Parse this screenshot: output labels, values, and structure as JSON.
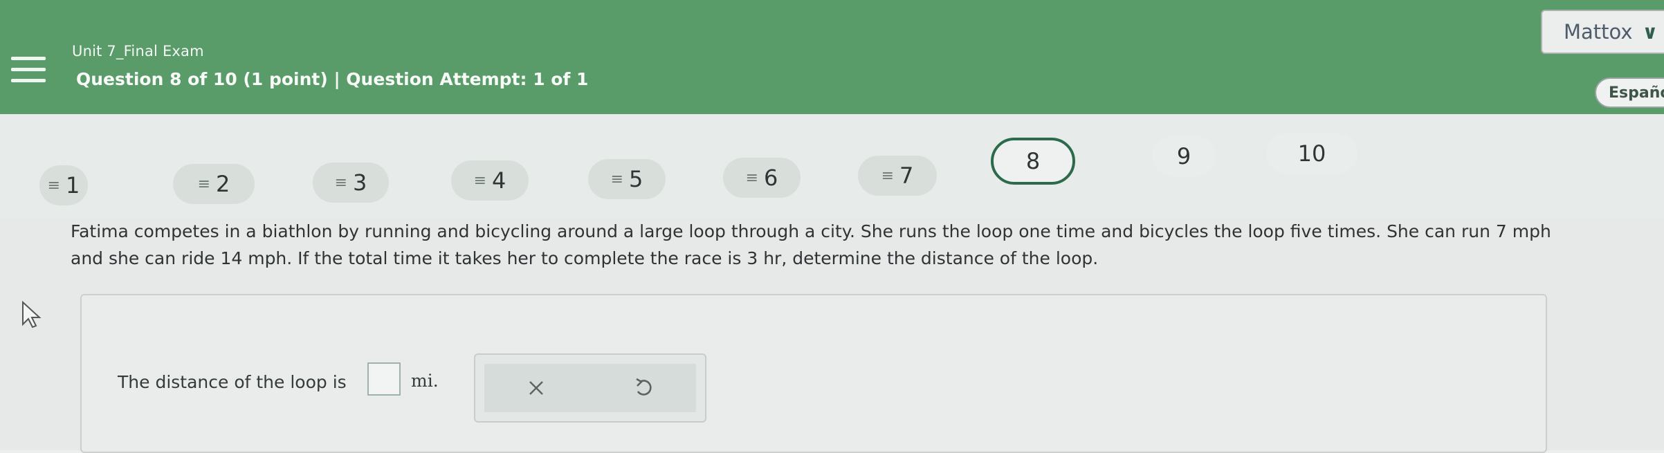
{
  "header": {
    "unit_title": "Unit 7_Final Exam",
    "question_info": "Question 8 of 10 (1 point)  |  Question Attempt: 1 of 1",
    "user_name": "Mattox",
    "language_button": "Español"
  },
  "question_nav": {
    "items": [
      "1",
      "2",
      "3",
      "4",
      "5",
      "6",
      "7",
      "8",
      "9",
      "10"
    ],
    "current": "8"
  },
  "question": {
    "prompt": "Fatima competes in a biathlon by running and bicycling around a large loop through a city. She runs the loop one time and bicycles the loop five times. She can run 7 mph and she can ride 14 mph. If the total time it takes her to complete the race is 3 hr, determine the distance of the loop.",
    "answer_label": "The distance of the loop is",
    "answer_value": "",
    "answer_unit": "mi."
  },
  "tools": {
    "clear_icon": "x-icon",
    "undo_icon": "undo-icon"
  },
  "colors": {
    "header_bg": "#5a9b6a",
    "current_border": "#2c6a4c"
  }
}
